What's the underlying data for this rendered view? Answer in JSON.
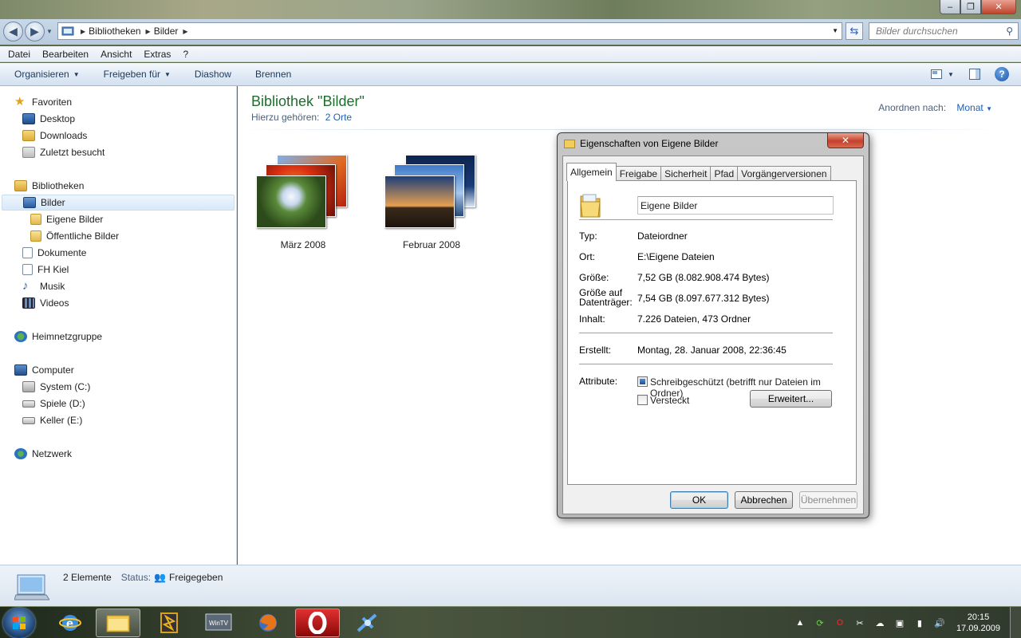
{
  "window": {
    "min_label": "–",
    "max_label": "❐",
    "close_label": "✕"
  },
  "address": {
    "crumbs": [
      "Bibliotheken",
      "Bilder"
    ],
    "search_placeholder": "Bilder durchsuchen"
  },
  "menu": [
    "Datei",
    "Bearbeiten",
    "Ansicht",
    "Extras",
    "?"
  ],
  "toolbar": {
    "organize": "Organisieren",
    "share": "Freigeben für",
    "slideshow": "Diashow",
    "burn": "Brennen"
  },
  "nav": {
    "favorites": "Favoriten",
    "desktop": "Desktop",
    "downloads": "Downloads",
    "recent": "Zuletzt besucht",
    "libraries": "Bibliotheken",
    "pictures": "Bilder",
    "my_pictures": "Eigene Bilder",
    "public_pictures": "Öffentliche Bilder",
    "documents": "Dokumente",
    "fh_kiel": "FH Kiel",
    "music": "Musik",
    "videos": "Videos",
    "homegroup": "Heimnetzgruppe",
    "computer": "Computer",
    "drive_c": "System (C:)",
    "drive_d": "Spiele (D:)",
    "drive_e": "Keller (E:)",
    "network": "Netzwerk"
  },
  "library": {
    "title": "Bibliothek \"Bilder\"",
    "includes_label": "Hierzu gehören:",
    "includes_link": "2 Orte",
    "arrange_label": "Anordnen nach:",
    "arrange_value": "Monat"
  },
  "folders": [
    {
      "label": "März 2008"
    },
    {
      "label": "Februar 2008"
    }
  ],
  "status": {
    "count": "2 Elemente",
    "status_label": "Status:",
    "status_value": "Freigegeben"
  },
  "dialog": {
    "title": "Eigenschaften von Eigene Bilder",
    "tabs": [
      "Allgemein",
      "Freigabe",
      "Sicherheit",
      "Pfad",
      "Vorgängerversionen"
    ],
    "name": "Eigene Bilder",
    "type_label": "Typ:",
    "type_value": "Dateiordner",
    "location_label": "Ort:",
    "location_value": "E:\\Eigene Dateien",
    "size_label": "Größe:",
    "size_value": "7,52 GB (8.082.908.474 Bytes)",
    "disk_label_1": "Größe auf",
    "disk_label_2": "Datenträger:",
    "disk_value": "7,54 GB (8.097.677.312 Bytes)",
    "contents_label": "Inhalt:",
    "contents_value": "7.226 Dateien, 473 Ordner",
    "created_label": "Erstellt:",
    "created_value": "Montag, 28. Januar 2008, 22:36:45",
    "attributes_label": "Attribute:",
    "readonly_label": "Schreibgeschützt (betrifft nur Dateien im Ordner)",
    "hidden_label": "Versteckt",
    "advanced_button": "Erweitert...",
    "ok_button": "OK",
    "cancel_button": "Abbrechen",
    "apply_button": "Übernehmen"
  },
  "taskbar": {
    "time": "20:15",
    "date": "17.09.2009"
  }
}
